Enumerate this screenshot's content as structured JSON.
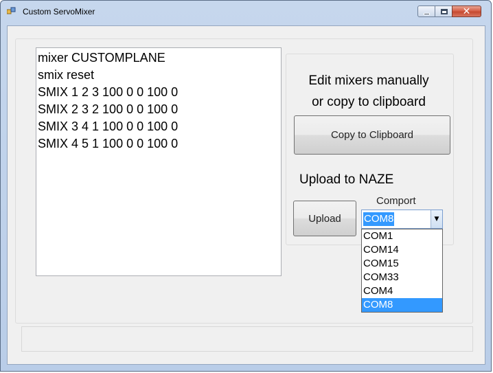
{
  "window": {
    "title": "Custom ServoMixer",
    "icon": "app-icon"
  },
  "mixer_text": {
    "lines": [
      "mixer CUSTOMPLANE",
      "smix reset",
      "SMIX 1 2 3 100 0 0 100 0",
      "SMIX 2 3 2 100 0 0 100 0",
      "SMIX 3 4 1 100 0 0 100 0",
      "SMIX 4 5 1 100 0 0 100 0"
    ]
  },
  "panel": {
    "info_line1": "Edit mixers manually",
    "info_line2": "or copy to clipboard",
    "copy_button": "Copy to Clipboard",
    "upload_label": "Upload to NAZE",
    "upload_button": "Upload",
    "comport_label": "Comport",
    "comport_selected": "COM8",
    "comport_options": [
      "COM1",
      "COM14",
      "COM15",
      "COM33",
      "COM4",
      "COM8"
    ]
  },
  "colors": {
    "selection": "#3399ff",
    "close_button": "#c54a30"
  }
}
